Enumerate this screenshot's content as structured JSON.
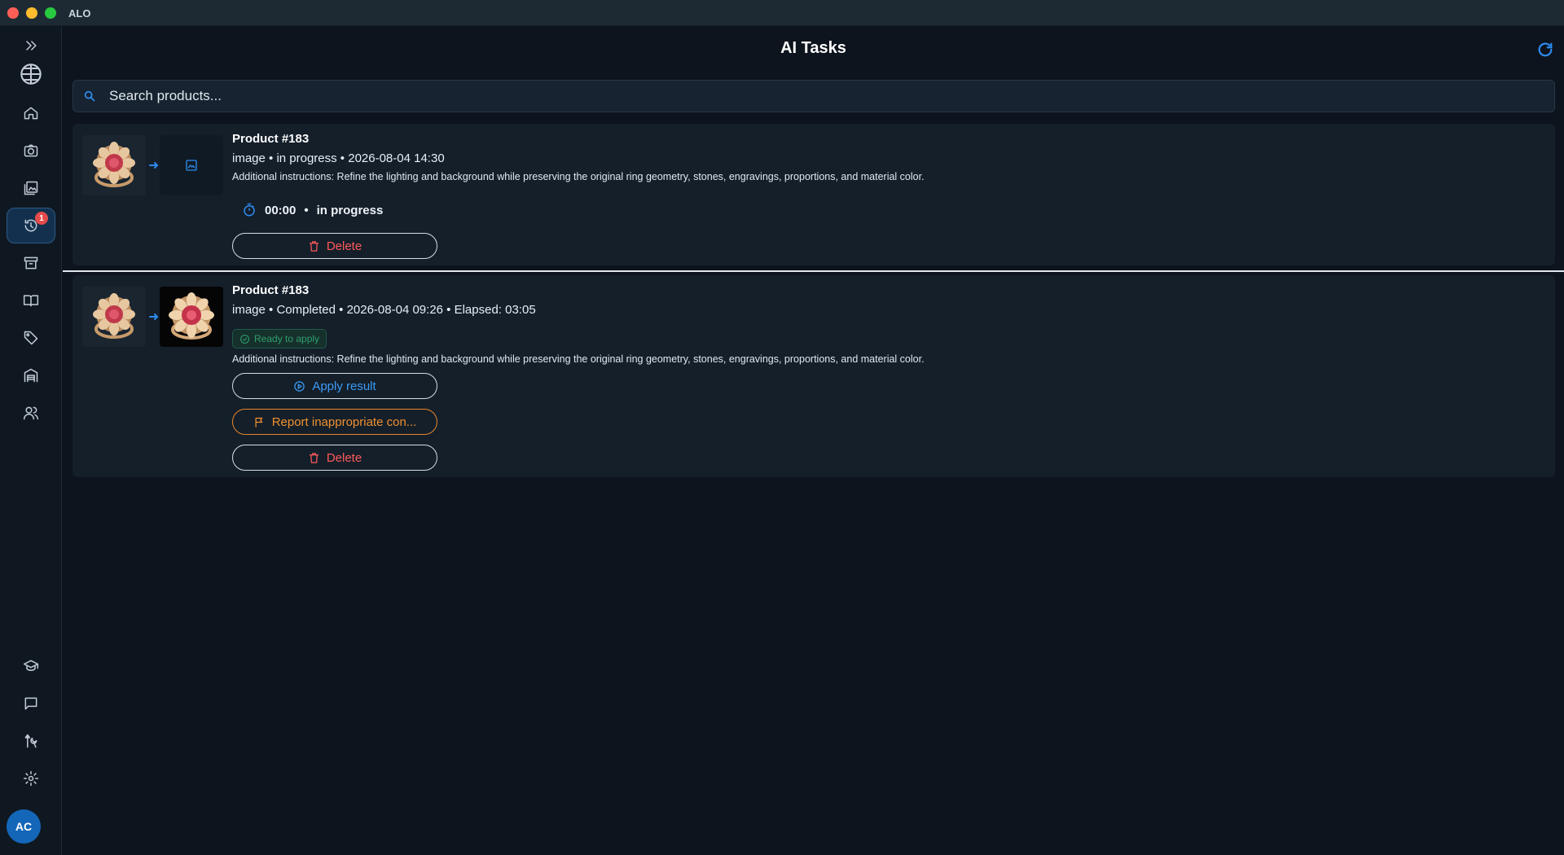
{
  "window": {
    "title": "ALO"
  },
  "sidebar": {
    "items": [
      {
        "icon": "double-chevron-right-icon"
      },
      {
        "icon": "globe-icon"
      },
      {
        "icon": "home-icon"
      },
      {
        "icon": "camera-icon"
      },
      {
        "icon": "gallery-icon"
      },
      {
        "icon": "history-icon",
        "badge": "1",
        "active": true
      },
      {
        "icon": "archive-icon"
      },
      {
        "icon": "book-icon"
      },
      {
        "icon": "tag-icon"
      },
      {
        "icon": "warehouse-icon"
      },
      {
        "icon": "users-icon"
      },
      {
        "icon": "graduation-cap-icon"
      },
      {
        "icon": "chat-icon"
      },
      {
        "icon": "tools-icon"
      },
      {
        "icon": "settings-icon"
      }
    ],
    "avatar_initials": "AC"
  },
  "header": {
    "title": "AI Tasks",
    "refresh_icon": "refresh-icon"
  },
  "search": {
    "placeholder": "Search products..."
  },
  "tasks": [
    {
      "title": "Product #183",
      "meta": "image • in progress • 2026-08-04 14:30",
      "instructions": "Additional instructions: Refine the lighting and background while preserving the original ring geometry, stones, engravings, proportions, and material color.",
      "timer": "00:00",
      "timer_sep": "•",
      "timer_status": "in progress",
      "delete_label": "Delete"
    },
    {
      "title": "Product #183",
      "meta": "image • Completed • 2026-08-04 09:26 • Elapsed: 03:05",
      "badge": "Ready to apply",
      "instructions": "Additional instructions: Refine the lighting and background while preserving the original ring geometry, stones, engravings, proportions, and material color.",
      "apply_label": "Apply result",
      "report_label": "Report inappropriate con...",
      "delete_label": "Delete"
    }
  ],
  "colors": {
    "accent": "#2d8cf0",
    "danger": "#ff5a5a",
    "warning": "#f0902e",
    "success": "#2ea06e",
    "background": "#0d141d"
  }
}
